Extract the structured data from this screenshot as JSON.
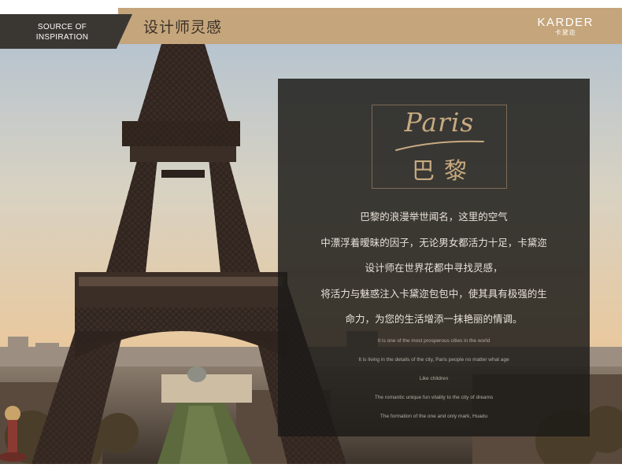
{
  "header": {
    "section_label_line1": "SOURCE OF",
    "section_label_line2": "INSPIRATION",
    "title": "设计师灵感",
    "brand_en": "KARDER",
    "brand_zh": "卡黛迩"
  },
  "feature": {
    "logo_script": "Paris",
    "logo_zh": "巴黎",
    "chinese_lines": [
      "巴黎的浪漫举世闻名，这里的空气",
      "中漂浮着暧昧的因子，无论男女都活力十足，卡黛迩",
      "设计师在世界花都中寻找灵感，",
      "将活力与魅惑注入卡黛迩包包中，使其具有极强的生",
      "命力，为您的生活增添一抹艳丽的情调。"
    ],
    "english_lines": [
      "It is one of the most prosperous cities in the world",
      "It is living in the details of the city, Paris people no matter what age",
      "Like children",
      "The romantic unique fun vitality to the city of dreams",
      "The formation of the one and only mark, Huadu"
    ]
  },
  "colors": {
    "header_gold": "#c5a57b",
    "header_dark": "#3a3733",
    "overlay": "#1c1a18",
    "accent_text": "#c7aa80"
  }
}
